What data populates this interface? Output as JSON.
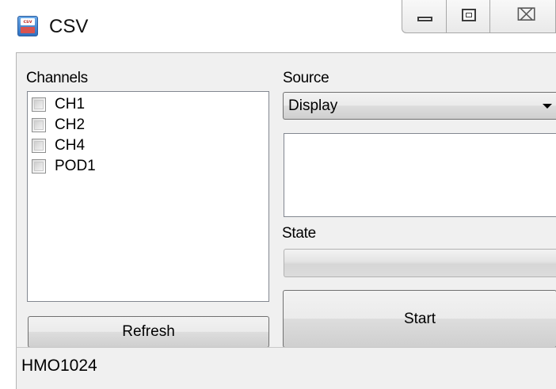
{
  "window": {
    "title": "CSV",
    "icon": "floppy-disk-icon"
  },
  "caption_buttons": {
    "minimize": "minimize-icon",
    "maximize": "maximize-icon",
    "close": "close-icon",
    "close_glyph": "⌧"
  },
  "channels": {
    "label": "Channels",
    "items": [
      {
        "label": "CH1",
        "checked": false
      },
      {
        "label": "CH2",
        "checked": false
      },
      {
        "label": "CH4",
        "checked": false
      },
      {
        "label": "POD1",
        "checked": false
      }
    ],
    "refresh_label": "Refresh"
  },
  "source": {
    "label": "Source",
    "selected": "Display"
  },
  "state": {
    "label": "State",
    "progress": 0
  },
  "actions": {
    "start_label": "Start"
  },
  "statusbar": {
    "device": "HMO1024"
  }
}
